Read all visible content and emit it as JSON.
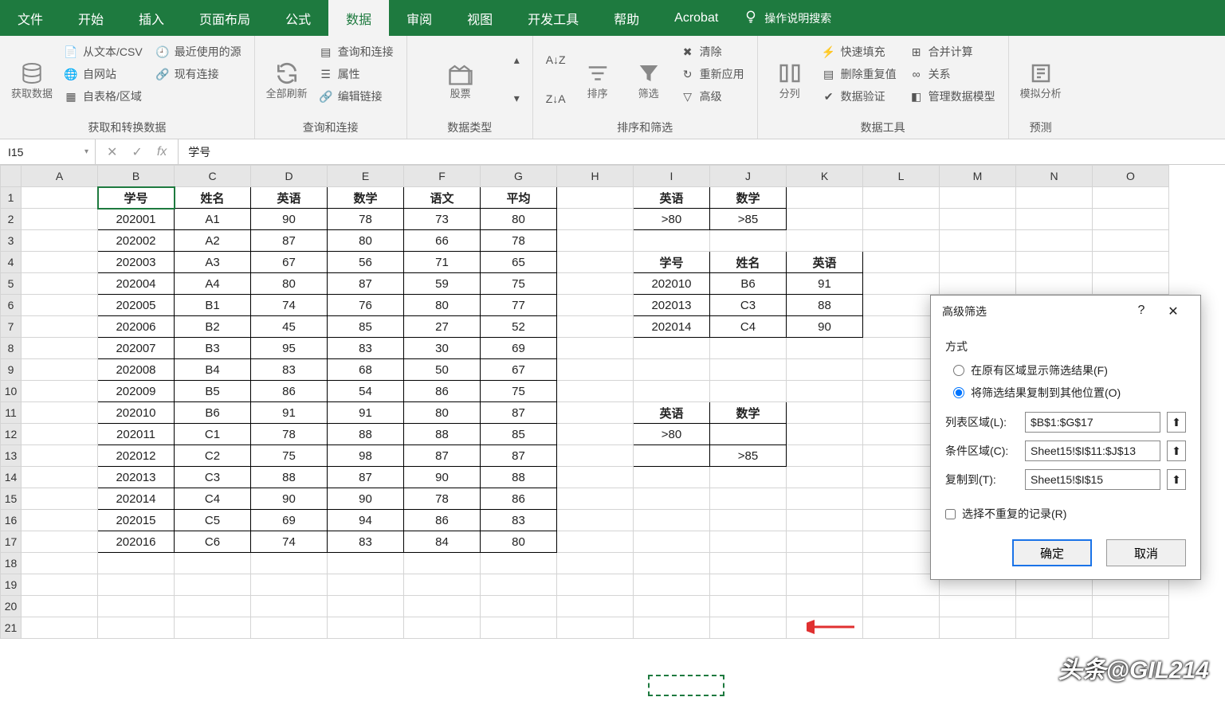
{
  "menu": {
    "tabs": [
      "文件",
      "开始",
      "插入",
      "页面布局",
      "公式",
      "数据",
      "审阅",
      "视图",
      "开发工具",
      "帮助",
      "Acrobat"
    ],
    "active": 5,
    "search": "操作说明搜索"
  },
  "ribbon": {
    "g1": {
      "label": "获取和转换数据",
      "big": "获取数据",
      "items": [
        "从文本/CSV",
        "自网站",
        "自表格/区域",
        "最近使用的源",
        "现有连接"
      ]
    },
    "g2": {
      "label": "查询和连接",
      "big": "全部刷新",
      "items": [
        "查询和连接",
        "属性",
        "编辑链接"
      ]
    },
    "g3": {
      "label": "数据类型",
      "big": "股票"
    },
    "g4": {
      "label": "排序和筛选",
      "b1": "排序",
      "b2": "筛选",
      "items": [
        "清除",
        "重新应用",
        "高级"
      ]
    },
    "g5": {
      "label": "数据工具",
      "big": "分列",
      "items": [
        "快速填充",
        "删除重复值",
        "数据验证",
        "合并计算",
        "关系",
        "管理数据模型"
      ]
    },
    "g6": {
      "label": "预测",
      "big": "模拟分析"
    }
  },
  "fbar": {
    "name": "I15",
    "formula": "学号"
  },
  "cols": [
    "A",
    "B",
    "C",
    "D",
    "E",
    "F",
    "G",
    "H",
    "I",
    "J",
    "K",
    "L",
    "M",
    "N",
    "O"
  ],
  "table1": {
    "head": [
      "学号",
      "姓名",
      "英语",
      "数学",
      "语文",
      "平均"
    ],
    "rows": [
      [
        "202001",
        "A1",
        "90",
        "78",
        "73",
        "80"
      ],
      [
        "202002",
        "A2",
        "87",
        "80",
        "66",
        "78"
      ],
      [
        "202003",
        "A3",
        "67",
        "56",
        "71",
        "65"
      ],
      [
        "202004",
        "A4",
        "80",
        "87",
        "59",
        "75"
      ],
      [
        "202005",
        "B1",
        "74",
        "76",
        "80",
        "77"
      ],
      [
        "202006",
        "B2",
        "45",
        "85",
        "27",
        "52"
      ],
      [
        "202007",
        "B3",
        "95",
        "83",
        "30",
        "69"
      ],
      [
        "202008",
        "B4",
        "83",
        "68",
        "50",
        "67"
      ],
      [
        "202009",
        "B5",
        "86",
        "54",
        "86",
        "75"
      ],
      [
        "202010",
        "B6",
        "91",
        "91",
        "80",
        "87"
      ],
      [
        "202011",
        "C1",
        "78",
        "88",
        "88",
        "85"
      ],
      [
        "202012",
        "C2",
        "75",
        "98",
        "87",
        "87"
      ],
      [
        "202013",
        "C3",
        "88",
        "87",
        "90",
        "88"
      ],
      [
        "202014",
        "C4",
        "90",
        "90",
        "78",
        "86"
      ],
      [
        "202015",
        "C5",
        "69",
        "94",
        "86",
        "83"
      ],
      [
        "202016",
        "C6",
        "74",
        "83",
        "84",
        "80"
      ]
    ]
  },
  "crit1": {
    "head": [
      "英语",
      "数学"
    ],
    "row": [
      ">80",
      ">85"
    ]
  },
  "result": {
    "head": [
      "学号",
      "姓名",
      "英语"
    ],
    "rows": [
      [
        "202010",
        "B6",
        "91"
      ],
      [
        "202013",
        "C3",
        "88"
      ],
      [
        "202014",
        "C4",
        "90"
      ]
    ]
  },
  "crit2": {
    "head": [
      "英语",
      "数学"
    ],
    "r1": [
      ">80",
      ""
    ],
    "r2": [
      "",
      ">85"
    ]
  },
  "dialog": {
    "title": "高级筛选",
    "sec": "方式",
    "opt1": "在原有区域显示筛选结果(F)",
    "opt2": "将筛选结果复制到其他位置(O)",
    "f1label": "列表区域(L):",
    "f1val": "$B$1:$G$17",
    "f2label": "条件区域(C):",
    "f2val": "Sheet15!$I$11:$J$13",
    "f3label": "复制到(T):",
    "f3val": "Sheet15!$I$15",
    "chk": "选择不重复的记录(R)",
    "ok": "确定",
    "cancel": "取消"
  },
  "watermark": "头条@GIL214"
}
